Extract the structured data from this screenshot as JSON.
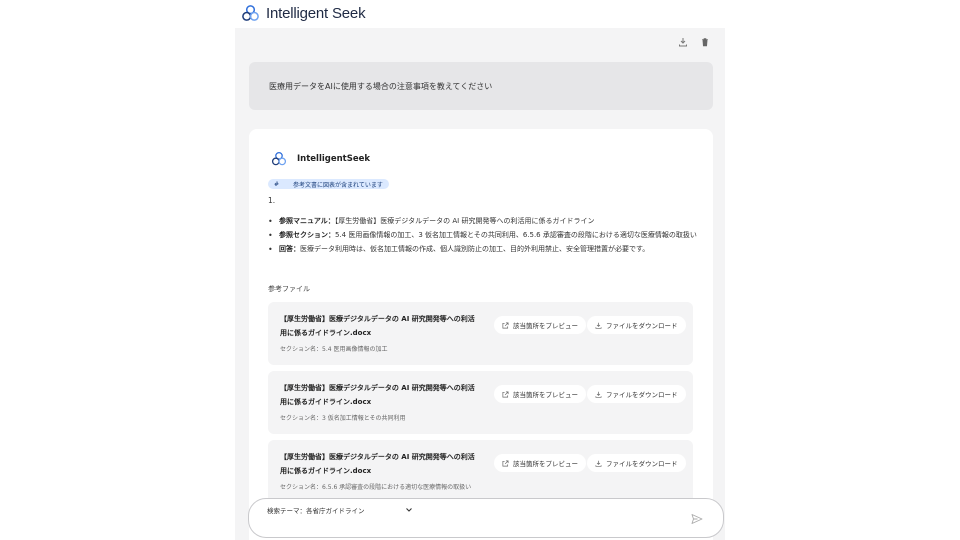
{
  "brand": {
    "name": "Intelligent Seek",
    "logo_icon": "hexagon-cluster-logo"
  },
  "toolbar": {
    "download_icon": "download-icon",
    "delete_icon": "trash-icon"
  },
  "user_message": "医療用データをAIに使用する場合の注意事項を教えてください",
  "answer": {
    "bot_name": "IntelligentSeek",
    "badge_hash": "#",
    "badge_text": "参考文書に図表が含まれています",
    "number_line": "1.",
    "bullets": [
      {
        "label": "参照マニュアル：",
        "text": "【厚生労働省】医療デジタルデータの AI 研究開発等への利活用に係るガイドライン"
      },
      {
        "label": "参照セクション：",
        "text": "5.4 医用画像情報の加工、3 仮名加工情報とその共同利用、6.5.6 承認審査の段階における適切な医療情報の取扱い"
      },
      {
        "label": "回答：",
        "text": "医療データ利用時は、仮名加工情報の作成、個人識別防止の加工、目的外利用禁止、安全管理措置が必要です。"
      }
    ],
    "ref_files_title": "参考ファイル",
    "ref_files": [
      {
        "name": "【厚生労働省】医療デジタルデータの AI 研究開発等への利活用に係るガイドライン.docx",
        "section": "セクション名：5.4 医用画像情報の加工"
      },
      {
        "name": "【厚生労働省】医療デジタルデータの AI 研究開発等への利活用に係るガイドライン.docx",
        "section": "セクション名：3 仮名加工情報とその共同利用"
      },
      {
        "name": "【厚生労働省】医療デジタルデータの AI 研究開発等への利活用に係るガイドライン.docx",
        "section": "セクション名：6.5.6 承認審査の段階における適切な医療情報の取扱い"
      }
    ],
    "preview_label": "該当箇所をプレビュー",
    "download_label": "ファイルをダウンロード"
  },
  "composer": {
    "theme_label": "検索テーマ：各省庁ガイドライン",
    "send_icon": "send-icon"
  },
  "colors": {
    "panel_bg": "#f4f4f5",
    "badge_bg": "#dbe9ff",
    "brand_text": "#1f2a44"
  }
}
